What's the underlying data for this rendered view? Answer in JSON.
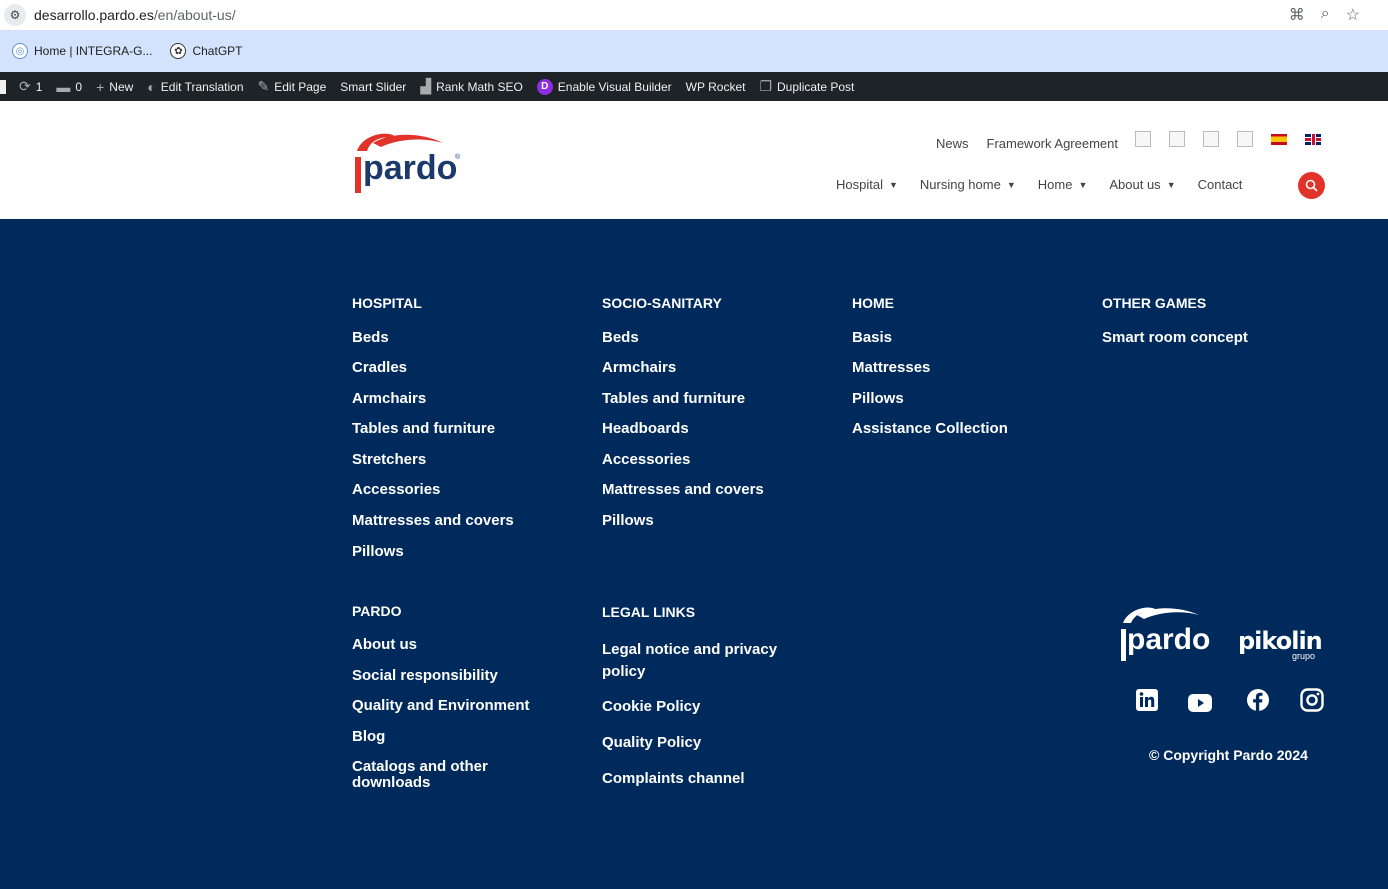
{
  "browser": {
    "url_domain": "desarrollo.pardo.es",
    "url_path": "/en/about-us/",
    "bookmarks": [
      {
        "label": "Home | INTEGRA-G...",
        "icon": "globe-icon"
      },
      {
        "label": "ChatGPT",
        "icon": "chatgpt-icon"
      }
    ]
  },
  "wp_admin_bar": {
    "updates_count": "1",
    "comments_count": "0",
    "new_label": "New",
    "edit_translation": "Edit Translation",
    "edit_page": "Edit Page",
    "smart_slider": "Smart Slider",
    "rank_math": "Rank Math SEO",
    "visual_builder": "Enable Visual Builder",
    "wp_rocket": "WP Rocket",
    "duplicate_post": "Duplicate Post"
  },
  "header": {
    "logo_text": "pardo",
    "top_nav": [
      "News",
      "Framework Agreement"
    ],
    "main_nav": [
      "Hospital",
      "Nursing home",
      "Home",
      "About us",
      "Contact"
    ],
    "accent_color": "#e2332a"
  },
  "footer": {
    "background": "#002a5c",
    "hospital": {
      "heading": "HOSPITAL",
      "links": [
        "Beds",
        "Cradles",
        "Armchairs",
        "Tables and furniture",
        "Stretchers",
        "Accessories",
        "Mattresses and covers",
        "Pillows"
      ]
    },
    "socio": {
      "heading": "SOCIO-SANITARY",
      "links": [
        "Beds",
        "Armchairs",
        "Tables and furniture",
        "Headboards",
        "Accessories",
        "Mattresses and covers",
        "Pillows"
      ]
    },
    "home": {
      "heading": "HOME",
      "links": [
        "Basis",
        "Mattresses",
        "Pillows",
        "Assistance Collection"
      ]
    },
    "other": {
      "heading": "OTHER GAMES",
      "links": [
        "Smart room concept"
      ]
    },
    "pardo": {
      "heading": "PARDO",
      "links": [
        "About us",
        "Social responsibility",
        "Quality and Environment",
        "Blog",
        "Catalogs and other downloads"
      ]
    },
    "legal": {
      "heading": "LEGAL LINKS",
      "links": [
        "Legal notice and privacy policy",
        "Cookie Policy",
        "Quality Policy",
        "Complaints channel"
      ]
    },
    "logos": {
      "pardo": "pardo",
      "pikolin": "pikolin",
      "pikolin_sub": "grupo"
    },
    "social": [
      "linkedin-icon",
      "youtube-icon",
      "facebook-icon",
      "instagram-icon"
    ],
    "copyright": "© Copyright Pardo 2024"
  }
}
